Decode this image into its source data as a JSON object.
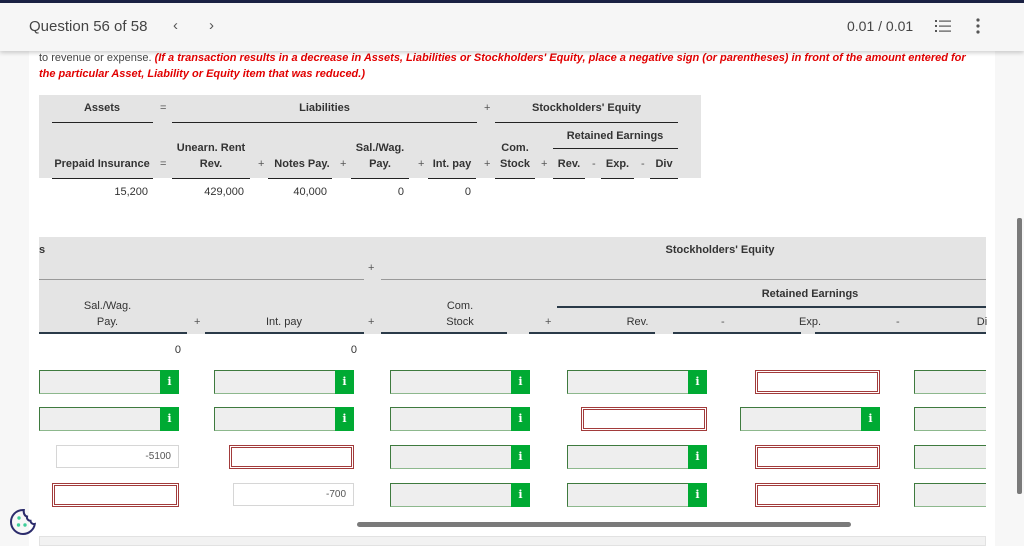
{
  "header": {
    "question_label": "Question 56 of 58",
    "prev_icon": "chevron-left",
    "next_icon": "chevron-right",
    "score": "0.01 / 0.01",
    "list_icon": "question-list-icon",
    "more_icon": "more-vertical-icon"
  },
  "instructions": {
    "prefix": "to revenue or expense. ",
    "note": "(If a transaction results in a decrease in Assets, Liabilities or Stockholders' Equity, place a negative sign (or parentheses) in front of the amount entered for the particular Asset, Liability or Equity item that was reduced.)"
  },
  "summary_table": {
    "groups": {
      "assets": "Assets",
      "eq": "=",
      "liabilities": "Liabilities",
      "plus": "+",
      "equity": "Stockholders' Equity",
      "retained": "Retained Earnings"
    },
    "columns": {
      "prepaid": "Prepaid Insurance",
      "unearn1": "Unearn. Rent",
      "unearn2": "Rev.",
      "notes": "Notes Pay.",
      "sal1": "Sal./Wag.",
      "sal2": "Pay.",
      "intpay": "Int. pay",
      "com1": "Com.",
      "com2": "Stock",
      "rev": "Rev.",
      "exp": "Exp.",
      "div": "Div"
    },
    "ops": {
      "eq": "=",
      "plus": "+",
      "minus": "-"
    },
    "values": {
      "prepaid": "15,200",
      "unearn": "429,000",
      "notes": "40,000",
      "sal": "0",
      "intpay": "0"
    }
  },
  "entry_table": {
    "cut_label": "s",
    "equity": "Stockholders' Equity",
    "retained": "Retained Earnings",
    "columns": {
      "sal1": "Sal./Wag.",
      "sal2": "Pay.",
      "intpay": "Int. pay",
      "com1": "Com.",
      "com2": "Stock",
      "rev": "Rev.",
      "exp": "Exp.",
      "div": "Di"
    },
    "ops": {
      "plus": "+",
      "minus": "-"
    },
    "totals": {
      "sal": "0",
      "intpay": "0"
    },
    "info_label": "i",
    "rows": [
      {
        "sal": "",
        "intpay": "",
        "com": "",
        "rev": "",
        "exp": ""
      },
      {
        "sal": "",
        "intpay": "",
        "com": "",
        "rev": "",
        "exp": ""
      },
      {
        "sal": "-5100",
        "intpay": "",
        "com": "",
        "rev": "",
        "exp": ""
      },
      {
        "sal": "",
        "intpay": "-700",
        "com": "",
        "rev": "",
        "exp": ""
      }
    ]
  },
  "colors": {
    "correct_green": "#00aa33",
    "incorrect_red": "#a23b3b",
    "instruction_red": "#e10000",
    "header_dark": "#1b2244",
    "cookie_teal": "#3ecf9a"
  }
}
